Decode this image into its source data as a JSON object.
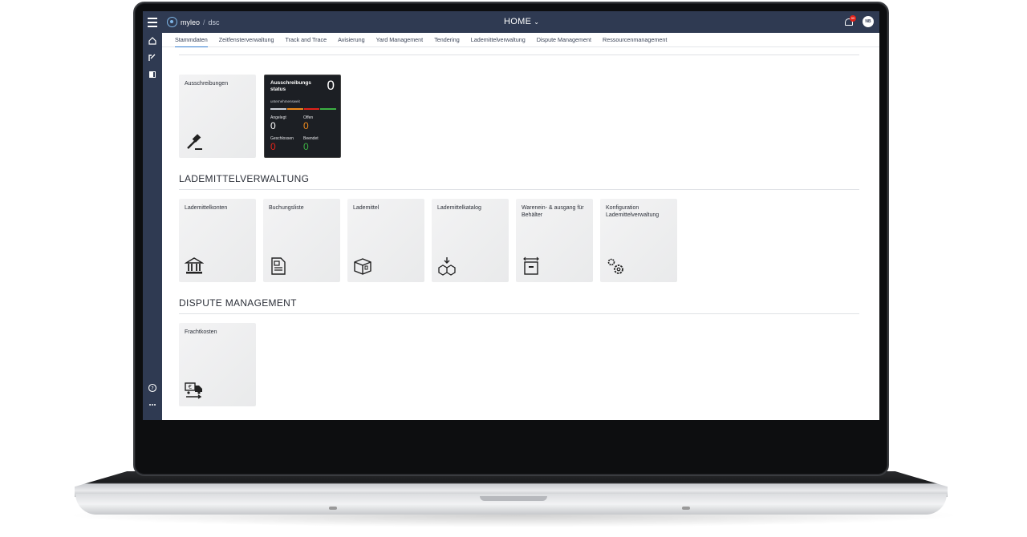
{
  "app": {
    "brand": "myleo",
    "brand_sub": "dsc",
    "home_label": "HOME",
    "notifications": "99",
    "avatar": "NB"
  },
  "tabs": [
    "Stammdaten",
    "Zeitfensterverwaltung",
    "Track and Trace",
    "Avisierung",
    "Yard Management",
    "Tendering",
    "Lademittelverwaltung",
    "Dispute Management",
    "Ressourcenmanagement"
  ],
  "tender": {
    "tile_label": "Ausschreibungen",
    "status": {
      "title": "Ausschreibungs status",
      "total": "0",
      "scope": "unternehmensweit",
      "items": [
        {
          "label": "Angelegt",
          "value": "0",
          "color": "#ffffff"
        },
        {
          "label": "Offen",
          "value": "0",
          "color": "#f08a1c"
        },
        {
          "label": "Geschlossen",
          "value": "0",
          "color": "#e2231a"
        },
        {
          "label": "Beendet",
          "value": "0",
          "color": "#3cb043"
        }
      ]
    }
  },
  "sections": [
    {
      "title": "LADEMITTELVERWALTUNG",
      "tiles": [
        {
          "label": "Lademittelkonten",
          "icon": "bank-icon"
        },
        {
          "label": "Buchungsliste",
          "icon": "document-icon"
        },
        {
          "label": "Lademittel",
          "icon": "box-icon"
        },
        {
          "label": "Lademittelkatalog",
          "icon": "boxes-arrow-icon"
        },
        {
          "label": "Warenein- & ausgang für Behälter",
          "icon": "container-icon"
        },
        {
          "label": "Konfiguration Lademittelverwaltung",
          "icon": "gears-icon"
        }
      ]
    },
    {
      "title": "DISPUTE MANAGEMENT",
      "tiles": [
        {
          "label": "Frachtkosten",
          "icon": "truck-cost-icon"
        }
      ]
    }
  ]
}
